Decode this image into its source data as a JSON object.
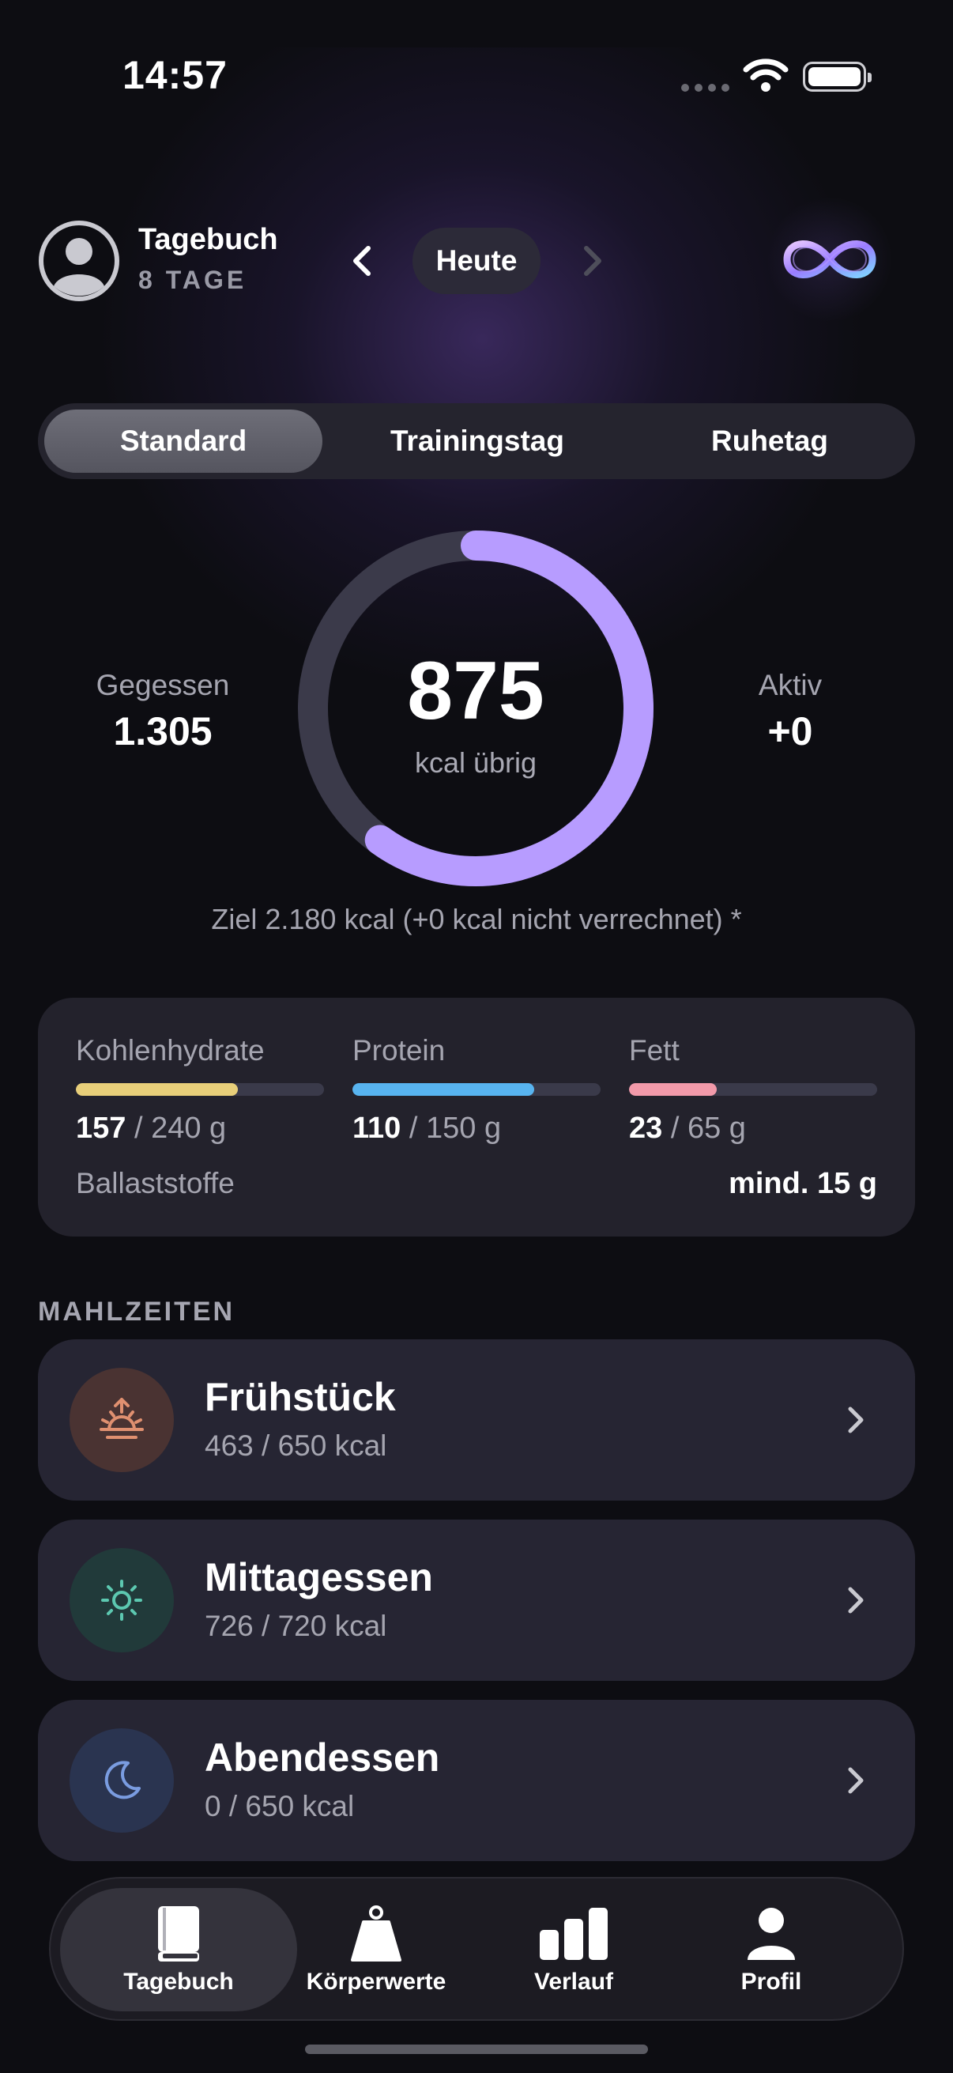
{
  "status_bar": {
    "time": "14:57"
  },
  "header": {
    "title": "Tagebuch",
    "subtitle": "8 TAGE",
    "date_label": "Heute"
  },
  "segments": [
    {
      "label": "Standard",
      "active": true
    },
    {
      "label": "Trainingstag",
      "active": false
    },
    {
      "label": "Ruhetag",
      "active": false
    }
  ],
  "calories": {
    "eaten_label": "Gegessen",
    "eaten_value": "1.305",
    "remaining_value": "875",
    "remaining_label": "kcal übrig",
    "active_label": "Aktiv",
    "active_value": "+0",
    "progress_fraction": 0.6,
    "goal_text": "Ziel 2.180 kcal (+0 kcal nicht verrechnet) *",
    "ring_color": "#b79cff",
    "track_color": "#3b3a4a"
  },
  "macros": {
    "items": [
      {
        "name": "Kohlenhydrate",
        "current": "157",
        "target": " / 240 g",
        "fraction": 0.654,
        "color": "#e8cf7a"
      },
      {
        "name": "Protein",
        "current": "110",
        "target": " / 150 g",
        "fraction": 0.733,
        "color": "#58b4f0"
      },
      {
        "name": "Fett",
        "current": "23",
        "target": " / 65 g",
        "fraction": 0.354,
        "color": "#f29aaa"
      }
    ],
    "fiber_label": "Ballaststoffe",
    "fiber_value": "mind. 15 g"
  },
  "meals_section": {
    "title": "MAHLZEITEN",
    "items": [
      {
        "name": "Frühstück",
        "kcal": "463 / 650 kcal",
        "icon": "sunrise-icon",
        "icon_bg": "#4a3332",
        "icon_color": "#e09070"
      },
      {
        "name": "Mittagessen",
        "kcal": "726 / 720 kcal",
        "icon": "sun-icon",
        "icon_bg": "#213a3a",
        "icon_color": "#5cc8b0"
      },
      {
        "name": "Abendessen",
        "kcal": "0 / 650 kcal",
        "icon": "moon-icon",
        "icon_bg": "#2a3450",
        "icon_color": "#7a9ce0"
      }
    ]
  },
  "tabbar": {
    "items": [
      {
        "label": "Tagebuch",
        "icon": "book-icon",
        "active": true
      },
      {
        "label": "Körperwerte",
        "icon": "scale-weight-icon",
        "active": false
      },
      {
        "label": "Verlauf",
        "icon": "bar-chart-icon",
        "active": false
      },
      {
        "label": "Profil",
        "icon": "person-icon",
        "active": false
      }
    ]
  }
}
